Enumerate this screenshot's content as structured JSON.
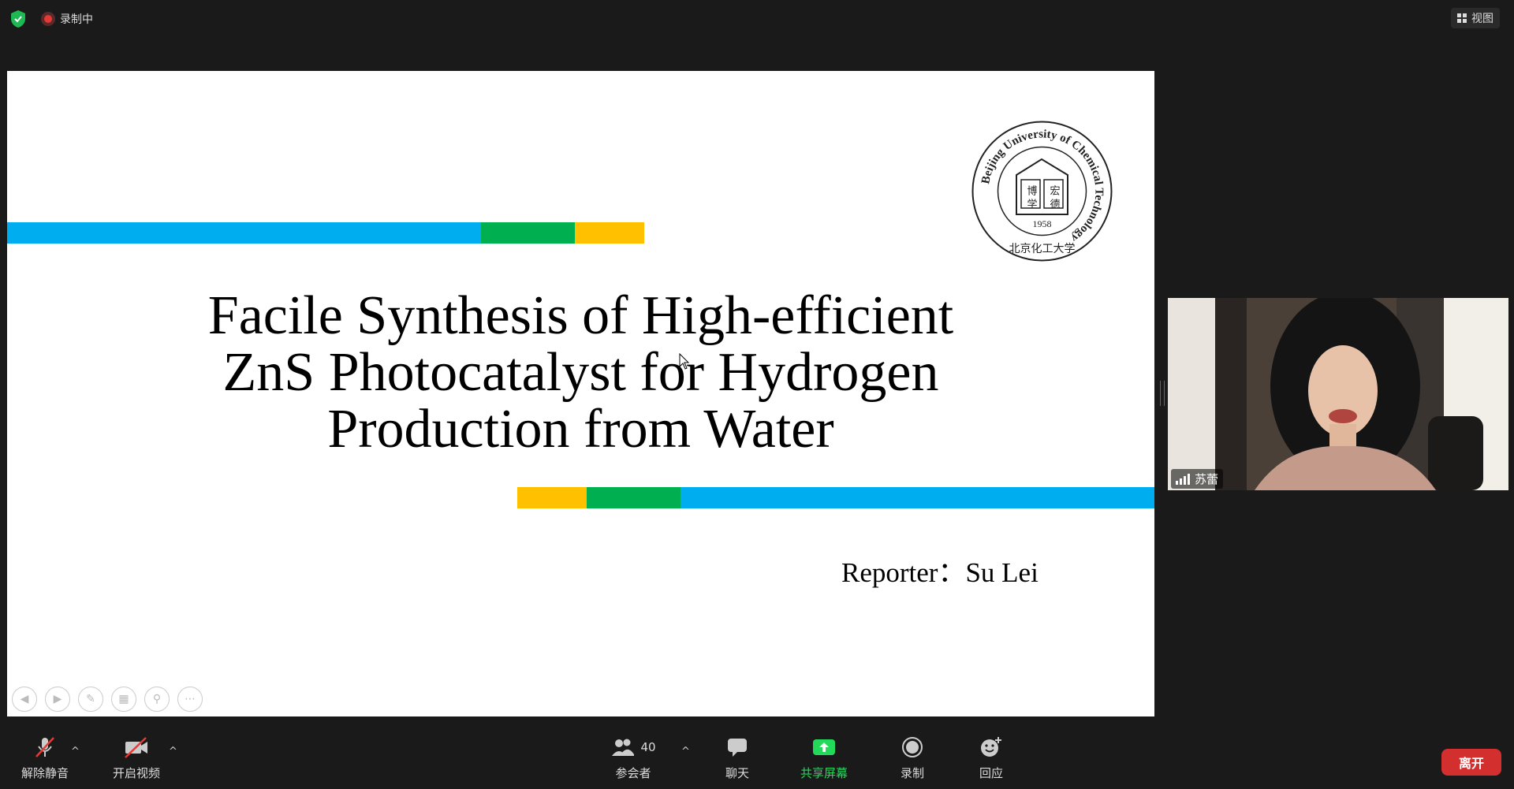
{
  "top": {
    "recording_label": "录制中",
    "view_label": "视图"
  },
  "slide": {
    "title_lines": [
      "Facile Synthesis of High-efficient",
      "ZnS Photocatalyst for Hydrogen",
      "Production from Water"
    ],
    "reporter": "Reporter：Su Lei",
    "seal": {
      "text": "Beijing University of Chemical Technology",
      "year": "1958",
      "chars_left": "博 学",
      "chars_right": "宏 德",
      "bottom": "北京化工大学"
    },
    "colors": {
      "blue": "#00aeef",
      "green": "#00b050",
      "yellow": "#ffc000"
    }
  },
  "video": {
    "name": "苏蕾"
  },
  "toolbar": {
    "mute_label": "解除静音",
    "video_label": "开启视频",
    "participants_label": "参会者",
    "participants_count": "40",
    "chat_label": "聊天",
    "share_label": "共享屏幕",
    "record_label": "录制",
    "reactions_label": "回应",
    "leave_label": "离开"
  },
  "icons": [
    "shield-icon",
    "record-icon",
    "grid-icon",
    "mic-muted-icon",
    "camera-off-icon",
    "participants-icon",
    "chat-icon",
    "share-screen-icon",
    "record-button-icon",
    "reaction-icon"
  ]
}
